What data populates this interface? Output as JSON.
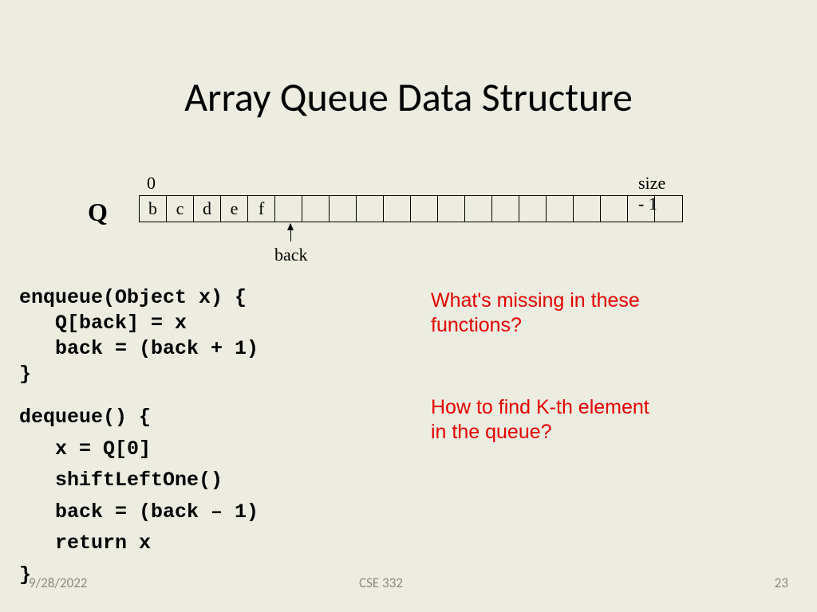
{
  "title": "Array Queue Data Structure",
  "array": {
    "label": "Q",
    "zero": "0",
    "size": "size - 1",
    "cells": [
      "b",
      "c",
      "d",
      "e",
      "f",
      "",
      "",
      "",
      "",
      "",
      "",
      "",
      "",
      "",
      "",
      "",
      "",
      "",
      "",
      ""
    ],
    "back": "back"
  },
  "code": {
    "enqueue": "enqueue(Object x) {\n   Q[back] = x\n   back = (back + 1)\n}",
    "dequeue": "dequeue() {\n   x = Q[0]\n   shiftLeftOne()\n   back = (back – 1)\n   return x\n}"
  },
  "questions": {
    "q1a": "What's missing in these",
    "q1b": "functions?",
    "q2a": "How to find K-th element",
    "q2b": "in the queue?"
  },
  "footer": {
    "date": "9/28/2022",
    "course": "CSE 332",
    "page": "23"
  }
}
